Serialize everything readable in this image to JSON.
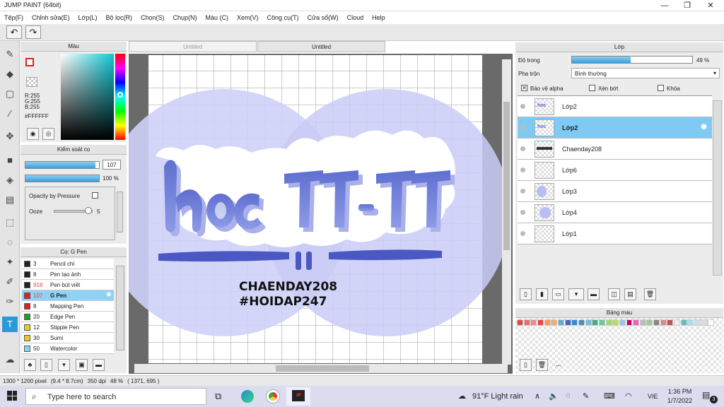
{
  "window": {
    "title": "JUMP PAINT (64bit)",
    "min": "—",
    "max": "❐",
    "close": "✕"
  },
  "menu": [
    "Tệp(F)",
    "Chỉnh sửa(E)",
    "Lớp(L)",
    "Bộ lọc(R)",
    "Chọn(S)",
    "Chụp(N)",
    "Màu (C)",
    "Xem(V)",
    "Công cụ(T)",
    "Cửa sổ(W)",
    "Cloud",
    "Help"
  ],
  "undo": {
    "undo": "↶",
    "redo": "↷"
  },
  "color_panel": {
    "title": "Màu",
    "r": "R:255",
    "g": "G:255",
    "b": "B:255",
    "hex": "#FFFFFF"
  },
  "brush_control": {
    "title": "Kiểm soát cọ",
    "size": "107",
    "size_fill": 0.95,
    "opacity": "100 %",
    "opacity_fill": 1.0,
    "opacity_by_pressure": "Opacity by Pressure",
    "ooze": "Ooze",
    "ooze_value": "5"
  },
  "brush_list": {
    "title": "Cọ: G Pen",
    "items": [
      {
        "num": "3",
        "name": "Pencil chì",
        "color": "#222222"
      },
      {
        "num": "8",
        "name": "Pen tạo ảnh",
        "color": "#222222"
      },
      {
        "num": "918",
        "name": "Pen bút viết",
        "color": "#222222"
      },
      {
        "num": "107",
        "name": "G Pen",
        "color": "#e02020"
      },
      {
        "num": "8",
        "name": "Mapping Pen",
        "color": "#e02020"
      },
      {
        "num": "20",
        "name": "Edge Pen",
        "color": "#20a020"
      },
      {
        "num": "12",
        "name": "Stipple Pen",
        "color": "#e0d020"
      },
      {
        "num": "30",
        "name": "Sumi",
        "color": "#e0d020"
      },
      {
        "num": "50",
        "name": "Watercolor",
        "color": "#80d8f0"
      }
    ]
  },
  "tabs": [
    "Untitled",
    "Untitled"
  ],
  "canvas": {
    "text1": "CHAENDAY208",
    "text2": "#HOIDAP247"
  },
  "layer_panel": {
    "title": "Lớp",
    "opacity_label": "Độ trong",
    "opacity_value": "49 %",
    "opacity_fill": 0.49,
    "blend_label": "Pha trộn",
    "blend_value": "Bình thường",
    "protect_alpha": "Bảo vệ alpha",
    "clip": "Xén bớt",
    "lock": "Khóa",
    "layers": [
      {
        "name": "Lớp2"
      },
      {
        "name": "Lớp2"
      },
      {
        "name": "Chaenday208"
      },
      {
        "name": "Lớp6"
      },
      {
        "name": "Lớp3"
      },
      {
        "name": "Lớp4"
      },
      {
        "name": "Lớp1"
      }
    ]
  },
  "palette": {
    "title": "Bảng màu",
    "colors": [
      "#e24a4a",
      "#e86b6b",
      "#f08a8a",
      "#e44",
      "#f59a59",
      "#ea7",
      "#6ac",
      "#46b",
      "#2a8fd6",
      "#58b",
      "#7bd",
      "#4a8",
      "#6c9",
      "#9d6",
      "#bd5",
      "#a0c4e8",
      "#c06",
      "#e6a",
      "#bbb",
      "#9c9",
      "#888",
      "#d88",
      "#b55",
      "#eee",
      "#6bb",
      "#ade",
      "#cde",
      "#ddd",
      "#fff"
    ],
    "extra": "---"
  },
  "status": {
    "size": "1300 * 1200 pixel",
    "cm": "(9.4 * 8.7cm)",
    "dpi": "350 dpi",
    "zoom": "48 %",
    "coords": "( 1371, 695 )"
  },
  "taskbar": {
    "search": "Type here to search",
    "weather": "91°F  Light rain",
    "lang": "VIE",
    "time": "1:36 PM",
    "date": "1/7/2022",
    "notif": "3"
  }
}
